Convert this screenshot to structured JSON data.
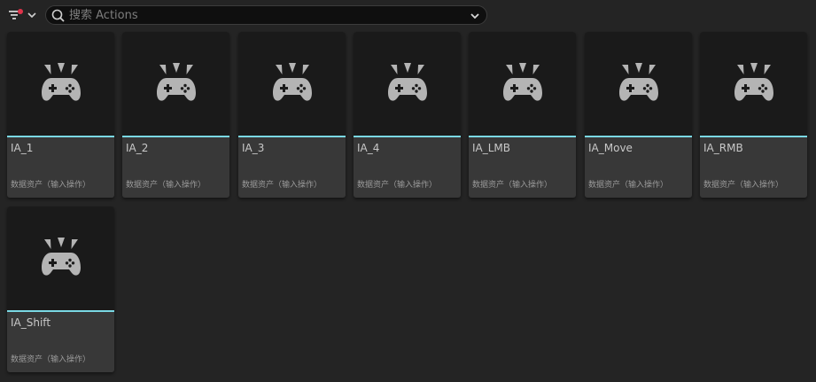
{
  "toolbar": {
    "filter_icon": "filter-icon",
    "search_placeholder": "搜索 Actions",
    "search_value": ""
  },
  "colors": {
    "accent": "#7ad8e4",
    "filter_dot": "#e0334a",
    "tile_bg": "#383838",
    "thumb_bg": "#1a1a1a"
  },
  "assets": [
    {
      "name": "IA_1",
      "type": "数据资产（输入操作）",
      "icon": "gamepad-icon"
    },
    {
      "name": "IA_2",
      "type": "数据资产（输入操作）",
      "icon": "gamepad-icon"
    },
    {
      "name": "IA_3",
      "type": "数据资产（输入操作）",
      "icon": "gamepad-icon"
    },
    {
      "name": "IA_4",
      "type": "数据资产（输入操作）",
      "icon": "gamepad-icon"
    },
    {
      "name": "IA_LMB",
      "type": "数据资产（输入操作）",
      "icon": "gamepad-icon"
    },
    {
      "name": "IA_Move",
      "type": "数据资产（输入操作）",
      "icon": "gamepad-icon"
    },
    {
      "name": "IA_RMB",
      "type": "数据资产（输入操作）",
      "icon": "gamepad-icon"
    },
    {
      "name": "IA_Shift",
      "type": "数据资产（输入操作）",
      "icon": "gamepad-icon"
    }
  ]
}
